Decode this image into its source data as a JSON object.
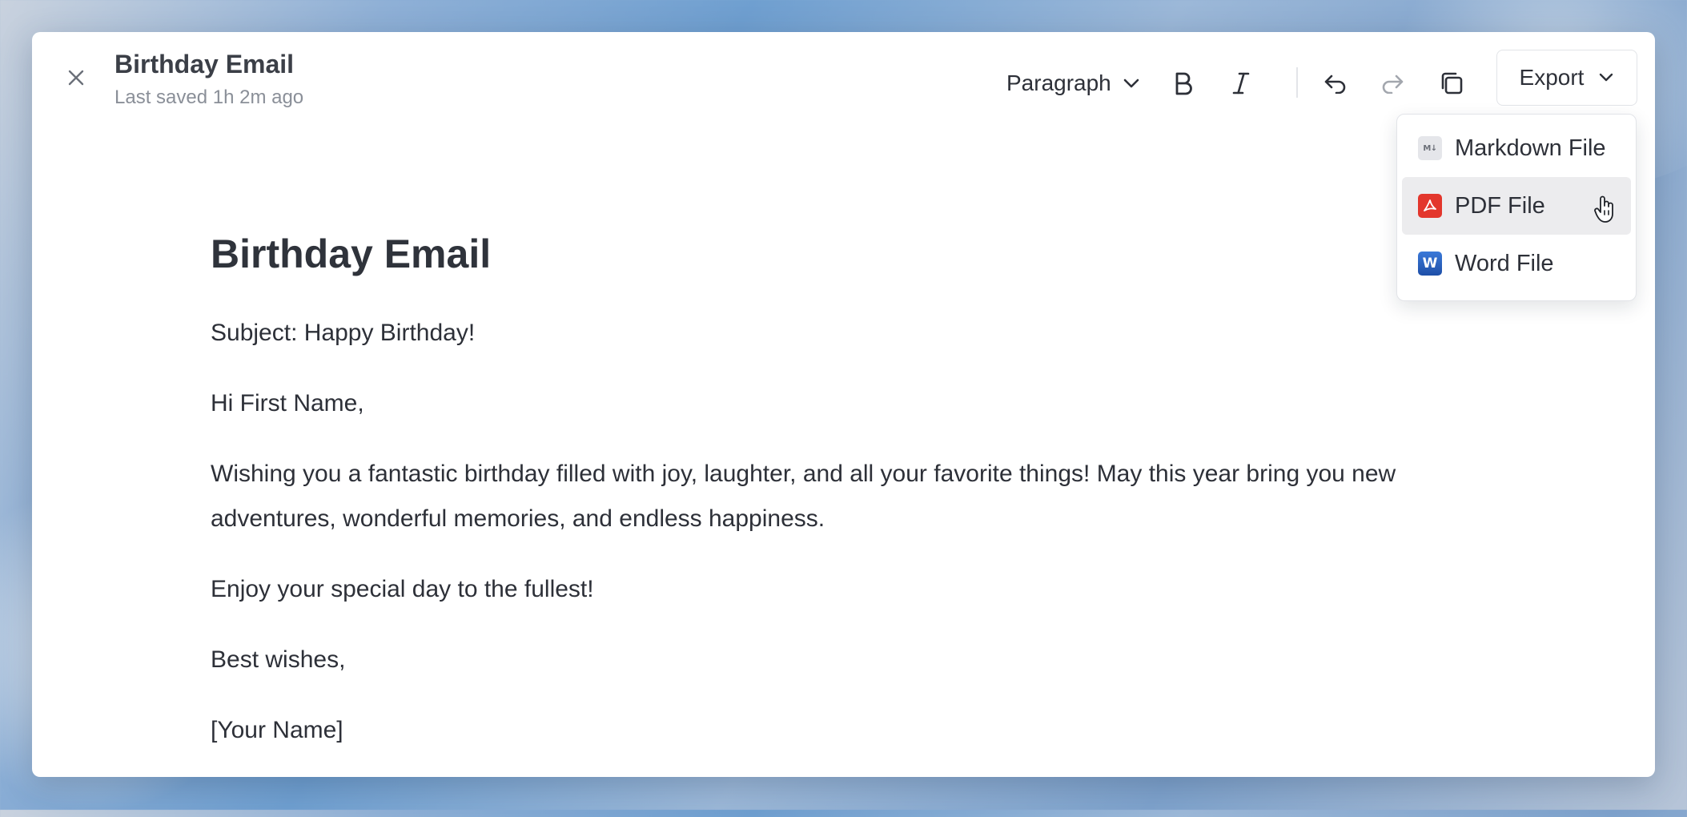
{
  "header": {
    "title": "Birthday Email",
    "last_saved": "Last saved 1h 2m ago"
  },
  "toolbar": {
    "paragraph_label": "Paragraph",
    "export_label": "Export"
  },
  "export_menu": {
    "items": [
      {
        "label": "Markdown File",
        "icon": "markdown-icon"
      },
      {
        "label": "PDF File",
        "icon": "pdf-icon",
        "hovered": true
      },
      {
        "label": "Word File",
        "icon": "word-icon"
      }
    ]
  },
  "document": {
    "heading": "Birthday Email",
    "paragraphs": [
      "Subject: Happy Birthday!",
      "Hi First Name,",
      "Wishing you a fantastic birthday filled with joy, laughter, and all your favorite things! May this year bring you new adventures, wonderful memories, and endless happiness.",
      "Enjoy your special day to the fullest!",
      "Best wishes,",
      "[Your Name]"
    ]
  },
  "colors": {
    "pdf": "#e3362c",
    "word": "#2b63c4",
    "hover_bg": "#ececee"
  }
}
